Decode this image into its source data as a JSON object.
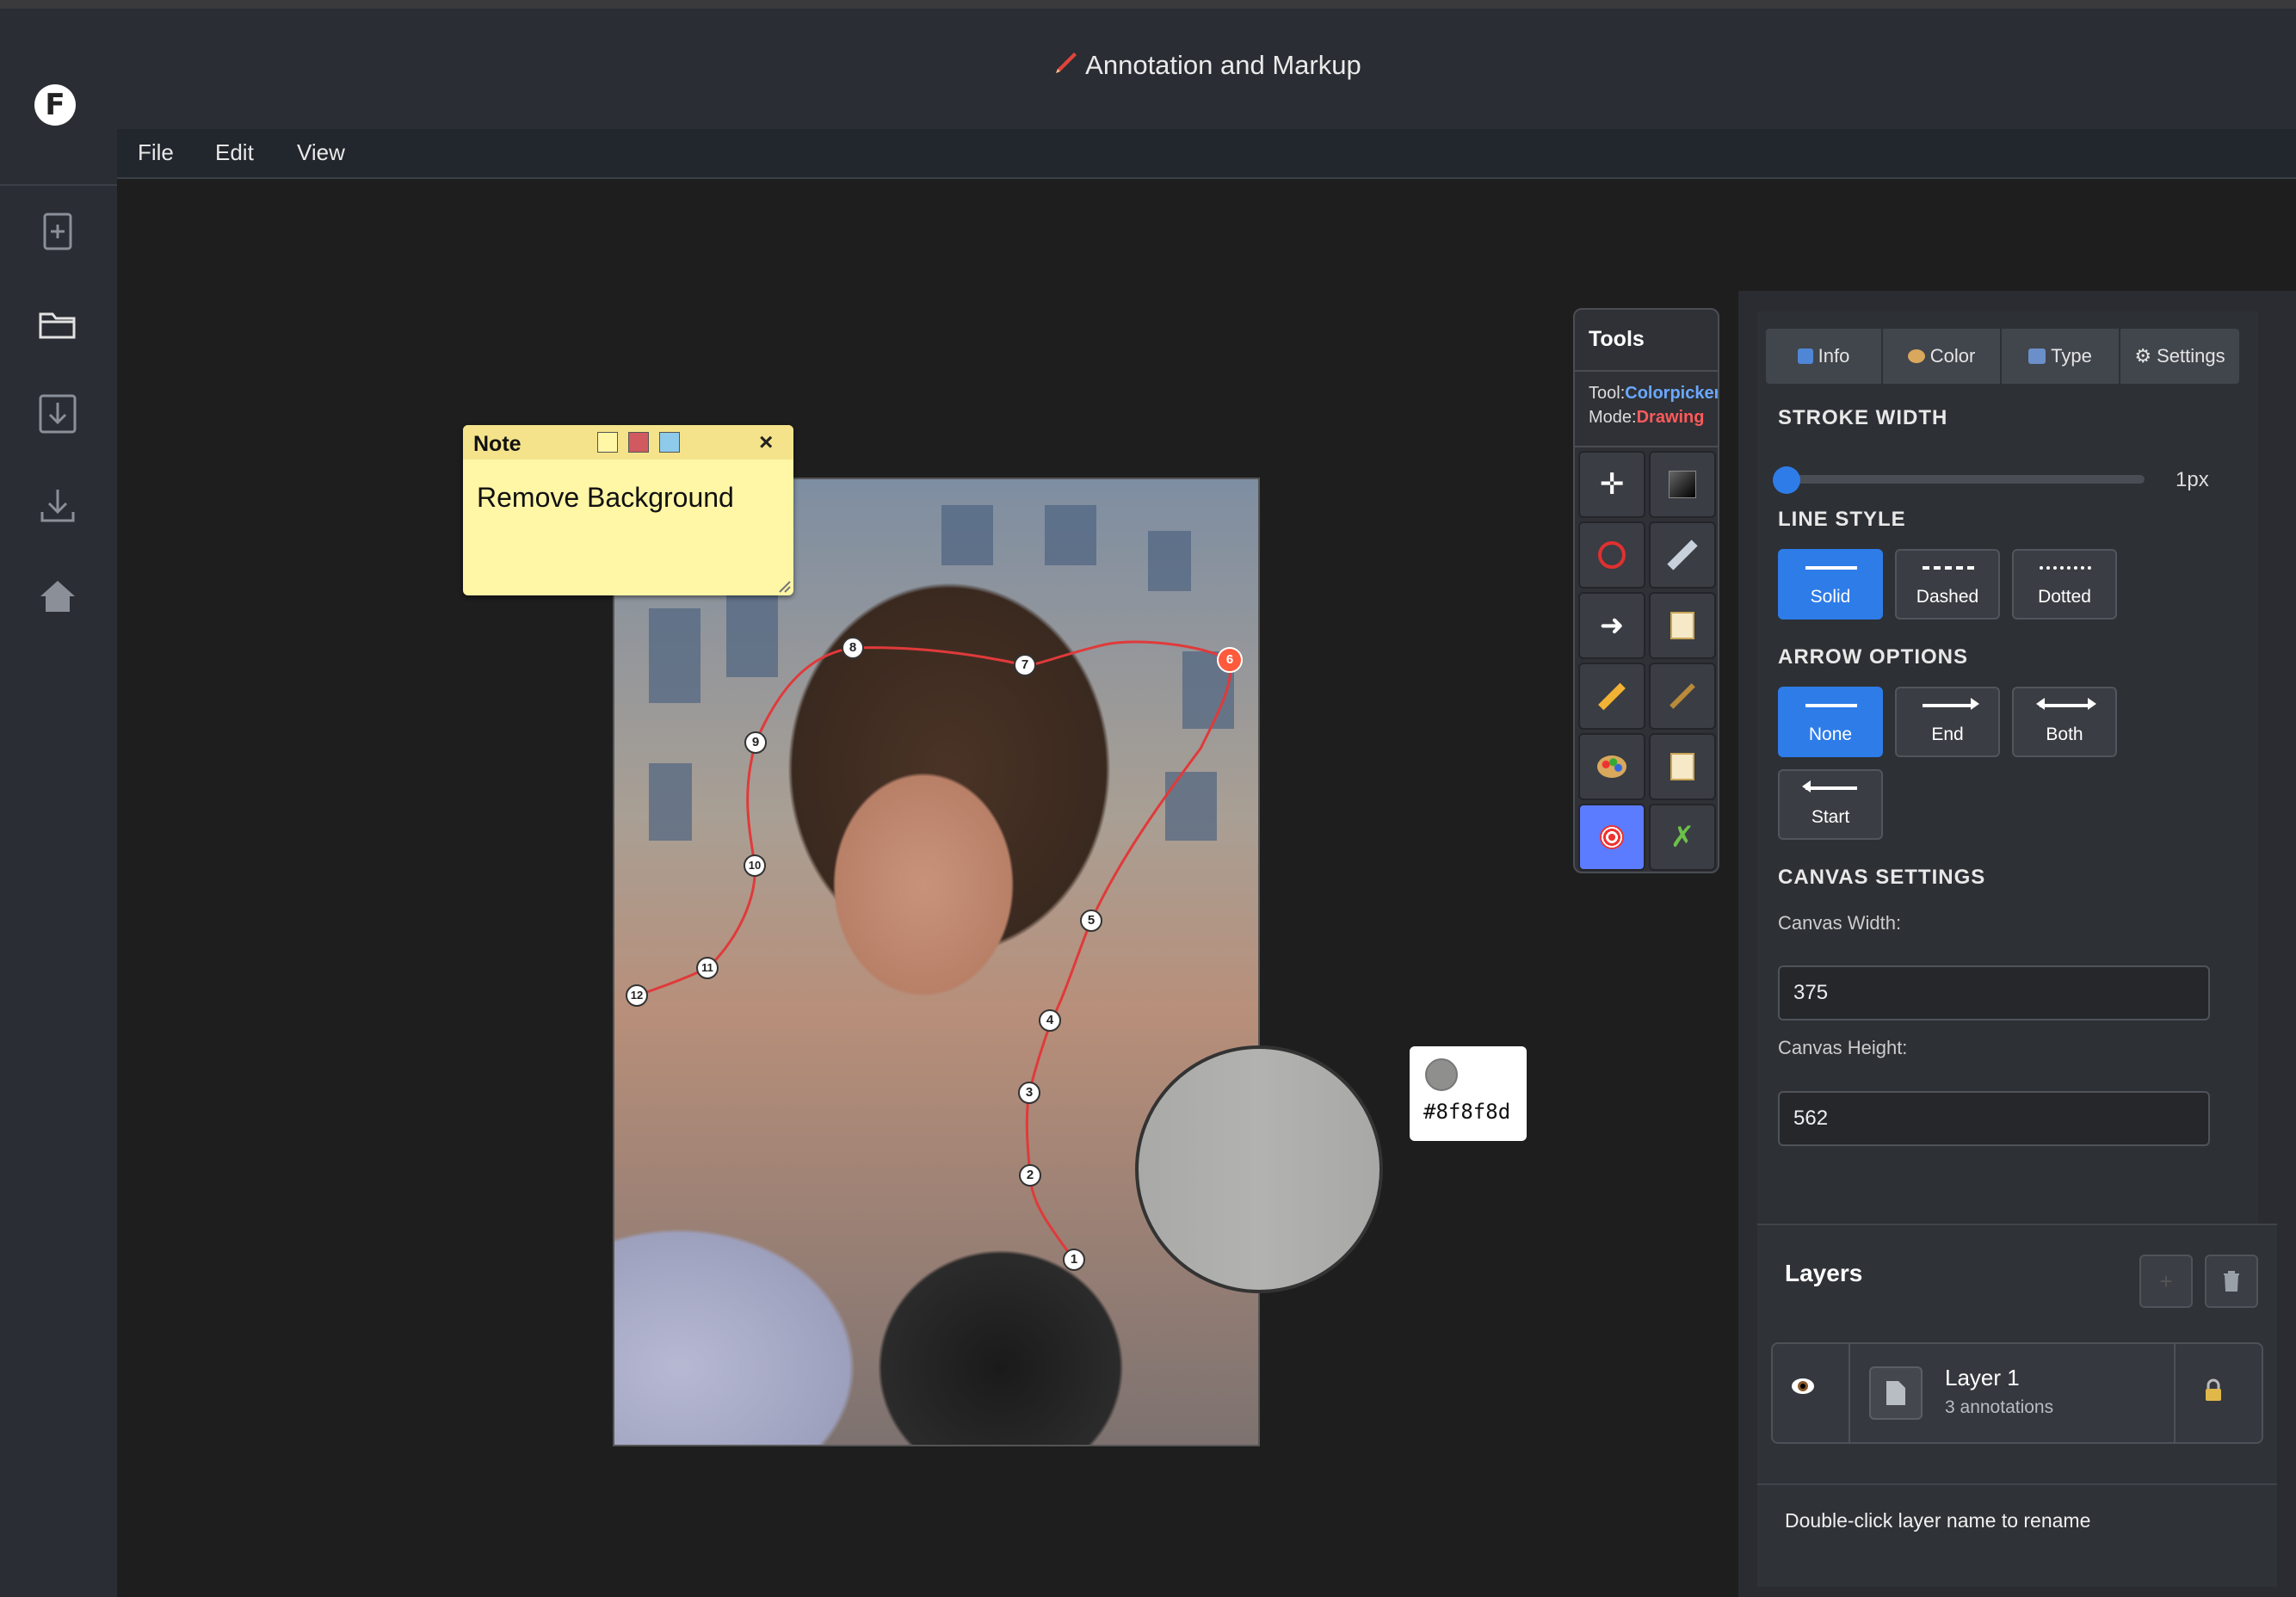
{
  "app": {
    "title_icon": "pencil-icon",
    "title": "Annotation and Markup",
    "logo_letter": "F"
  },
  "sidebar": {
    "icons": [
      "new-file-icon",
      "open-folder-icon",
      "import-icon",
      "download-icon",
      "home-icon"
    ]
  },
  "menu": {
    "file": "File",
    "edit": "Edit",
    "view": "View"
  },
  "note": {
    "title": "Note",
    "text": "Remove Background",
    "swatch_colors": [
      "#fff6a6",
      "#d05a60",
      "#8ecbea"
    ],
    "close": "×"
  },
  "path_points": [
    "1",
    "2",
    "3",
    "4",
    "5",
    "6",
    "7",
    "8",
    "9",
    "10",
    "11",
    "12"
  ],
  "colorpicker": {
    "hex": "#8f8f8d"
  },
  "tools": {
    "title": "Tools",
    "tool_label": "Tool:",
    "tool_value": "Colorpicker",
    "mode_label": "Mode:",
    "mode_value": "Drawing",
    "buttons": [
      "move-icon",
      "fill-rect-icon",
      "circle-icon",
      "ruler-icon",
      "arrow-icon",
      "memo-icon",
      "pencil-icon",
      "brush-icon",
      "palette-icon",
      "note-icon",
      "target-icon",
      "crop-icon"
    ]
  },
  "panel": {
    "tabs": {
      "info": "Info",
      "color": "Color",
      "type": "Type",
      "settings": "Settings"
    },
    "stroke_width": {
      "label": "STROKE WIDTH",
      "value": "1px"
    },
    "line_style": {
      "label": "LINE STYLE",
      "solid": "Solid",
      "dashed": "Dashed",
      "dotted": "Dotted",
      "selected": "Solid"
    },
    "arrow_options": {
      "label": "ARROW OPTIONS",
      "none": "None",
      "end": "End",
      "both": "Both",
      "start": "Start",
      "selected": "None"
    },
    "canvas_settings": {
      "label": "CANVAS SETTINGS",
      "width_label": "Canvas Width:",
      "width_value": "375",
      "height_label": "Canvas Height:",
      "height_value": "562"
    }
  },
  "layers": {
    "title": "Layers",
    "add": "+",
    "items": [
      {
        "name": "Layer 1",
        "meta": "3 annotations"
      }
    ],
    "hint": "Double-click layer name to rename"
  },
  "colors": {
    "accent": "#2e7ce8",
    "tool_value": "#6aa8ff",
    "mode_value": "#ff5a5a",
    "path": "#e03a3a",
    "active_point": "#ff5a3c"
  }
}
